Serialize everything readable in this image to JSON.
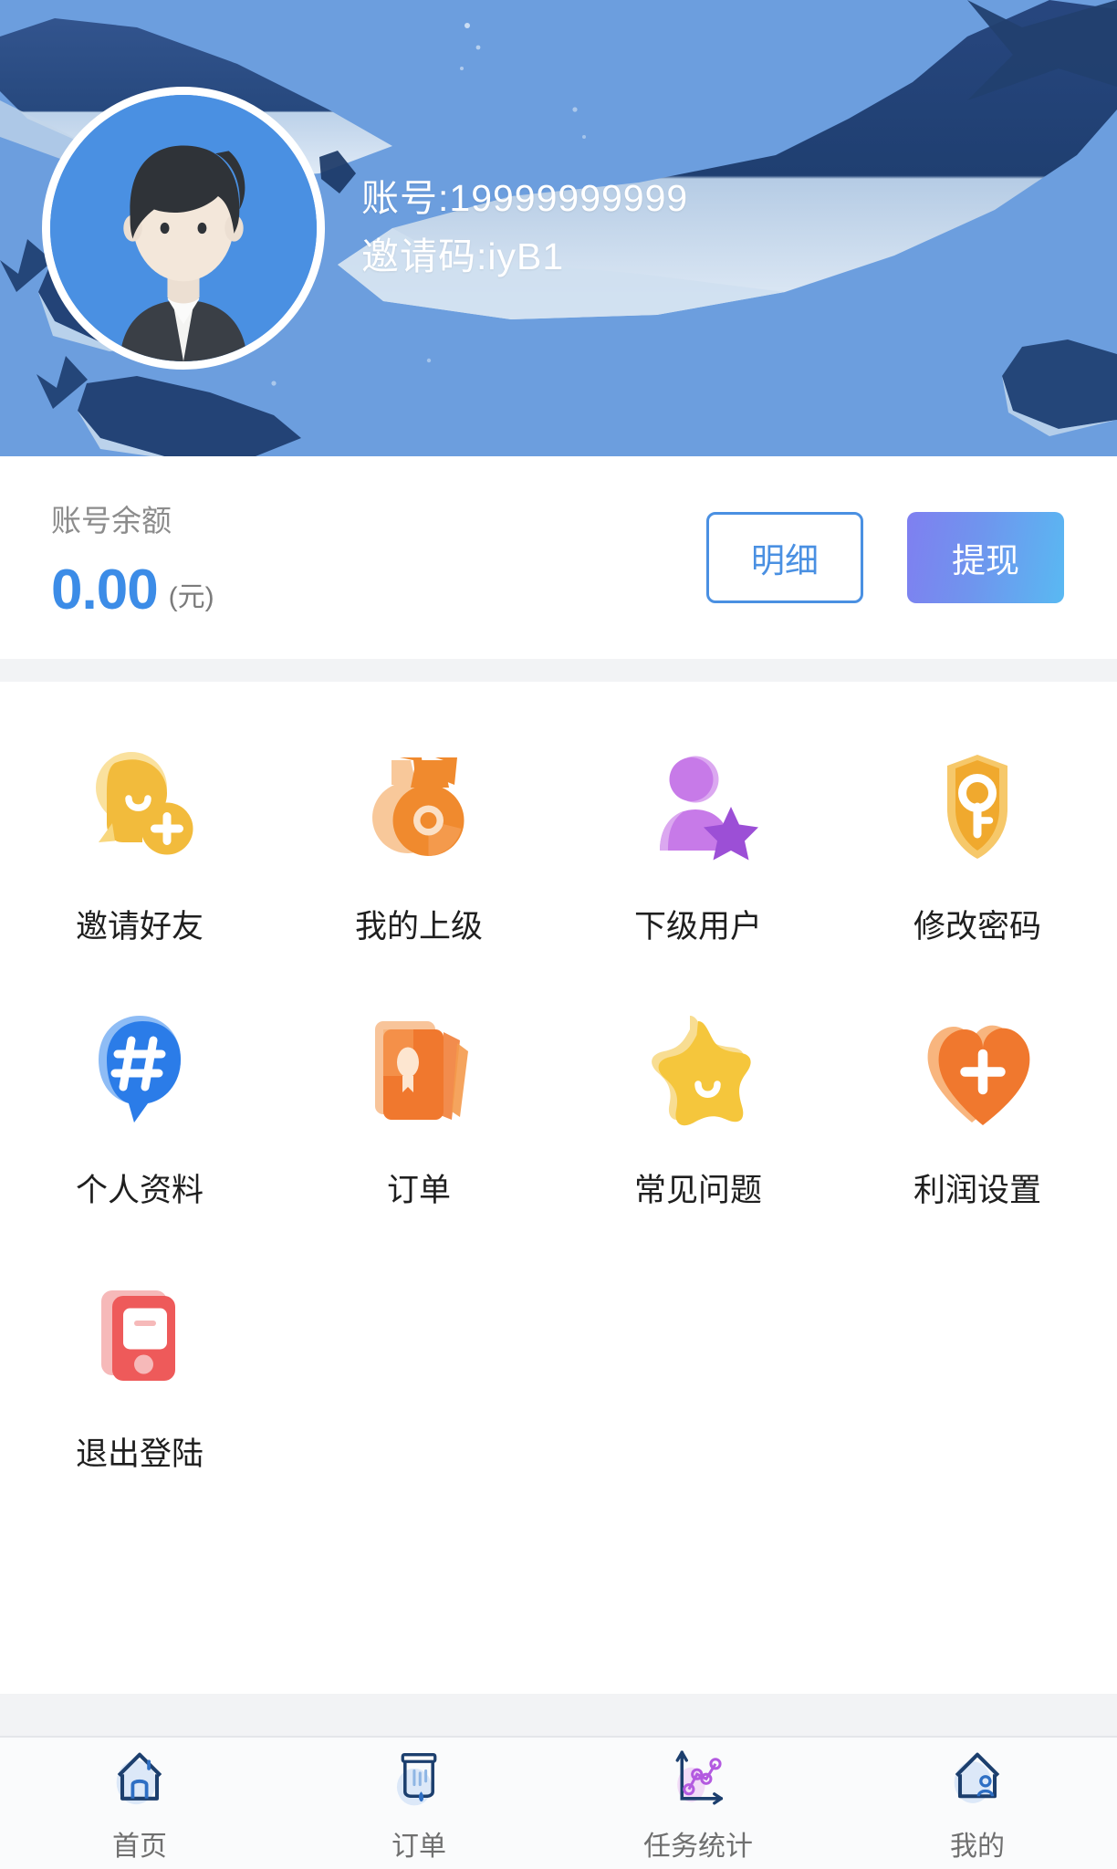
{
  "header": {
    "avatar_alt": "user-avatar",
    "account_line": "账号:19999999999",
    "invite_line": "邀请码:iyB1",
    "bg_color": "#6c9ede",
    "whale_color_dark": "#1b3a6b",
    "whale_color_light": "#d7e4f2"
  },
  "balance": {
    "label": "账号余额",
    "amount": "0.00",
    "unit": "(元)",
    "amount_color": "#3c8ce7",
    "detail_button": "明细",
    "withdraw_button": "提现",
    "withdraw_gradient_from": "#7f7ff0",
    "withdraw_gradient_to": "#59b9f2"
  },
  "menu": {
    "items": [
      {
        "label": "邀请好友",
        "icon": "invite-friends-icon",
        "color": "#f5c242"
      },
      {
        "label": "我的上级",
        "icon": "medal-icon",
        "color": "#f08a2e"
      },
      {
        "label": "下级用户",
        "icon": "user-star-icon",
        "color": "#c77ae8"
      },
      {
        "label": "修改密码",
        "icon": "shield-key-icon",
        "color": "#f0a92e"
      },
      {
        "label": "个人资料",
        "icon": "profile-hash-icon",
        "color": "#2b7ce8"
      },
      {
        "label": "订单",
        "icon": "order-cards-icon",
        "color": "#f0782e"
      },
      {
        "label": "常见问题",
        "icon": "star-icon",
        "color": "#f5c63c"
      },
      {
        "label": "利润设置",
        "icon": "heart-plus-icon",
        "color": "#f0782e"
      },
      {
        "label": "退出登陆",
        "icon": "logout-device-icon",
        "color": "#ee5a5a"
      }
    ]
  },
  "tabbar": {
    "tabs": [
      {
        "label": "首页",
        "icon": "home-icon"
      },
      {
        "label": "订单",
        "icon": "order-icon"
      },
      {
        "label": "任务统计",
        "icon": "statistics-icon"
      },
      {
        "label": "我的",
        "icon": "profile-icon"
      }
    ],
    "active_index": 3
  }
}
